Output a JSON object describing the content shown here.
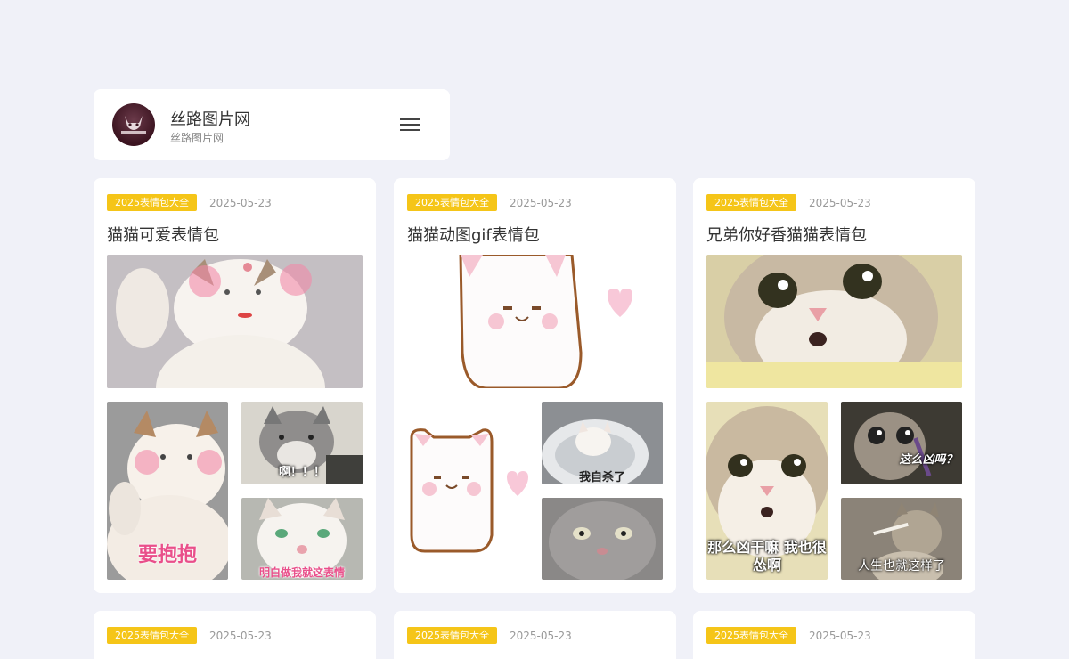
{
  "site": {
    "title": "丝路图片网",
    "subtitle": "丝路图片网",
    "logo_text": "LAZY BIRD FLY"
  },
  "posts": [
    {
      "tag": "2025表情包大全",
      "date": "2025-05-23",
      "title": "猫猫可爱表情包",
      "captions": [
        "",
        "要抱抱",
        "啊！！！",
        "明白做我就这表情"
      ]
    },
    {
      "tag": "2025表情包大全",
      "date": "2025-05-23",
      "title": "猫猫动图gif表情包",
      "captions": [
        "",
        "",
        "我自杀了",
        ""
      ]
    },
    {
      "tag": "2025表情包大全",
      "date": "2025-05-23",
      "title": "兄弟你好香猫猫表情包",
      "captions": [
        "",
        "那么凶干嘛 我也很怂啊",
        "这么凶吗？",
        "人生也就这样了"
      ]
    },
    {
      "tag": "2025表情包大全",
      "date": "2025-05-23"
    },
    {
      "tag": "2025表情包大全",
      "date": "2025-05-23"
    },
    {
      "tag": "2025表情包大全",
      "date": "2025-05-23"
    }
  ],
  "colors": {
    "background": "#f0f1f8",
    "tag": "#f5c518",
    "card": "#ffffff"
  }
}
